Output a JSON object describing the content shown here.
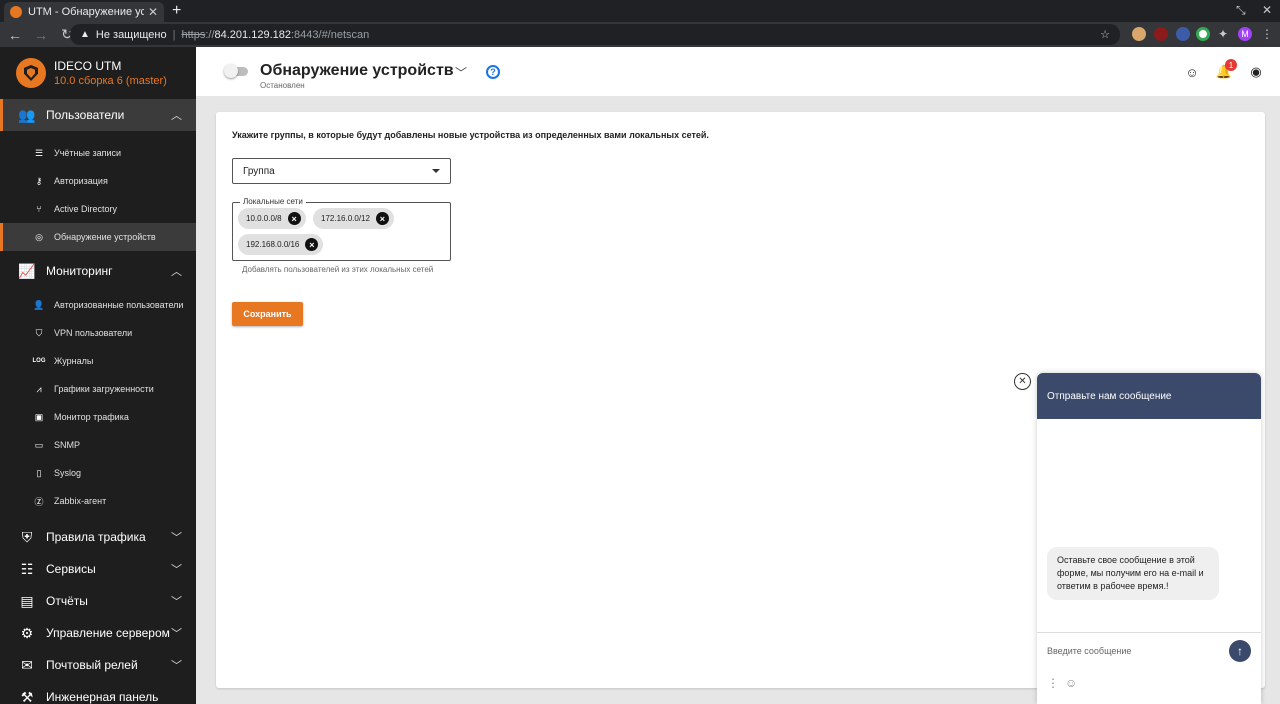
{
  "browser": {
    "tab_title": "UTM - Обнаружение устройс",
    "tab_close": "✕",
    "new_tab": "+",
    "security_label": "Не защищено",
    "url_protocol": "https",
    "url_host": "84.201.129.182",
    "url_path": ":8443/#/netscan",
    "avatar_letter": "M"
  },
  "sidebar": {
    "brand_name": "IDECO UTM",
    "brand_version": "10.0 сборка 6 (master)",
    "sections": [
      {
        "label": "Пользователи",
        "icon": "users-icon",
        "expanded": true,
        "items": [
          {
            "label": "Учётные записи",
            "icon": "list-icon"
          },
          {
            "label": "Авторизация",
            "icon": "key-icon"
          },
          {
            "label": "Active Directory",
            "icon": "tree-icon"
          },
          {
            "label": "Обнаружение устройств",
            "icon": "radar-icon",
            "active": true
          }
        ]
      },
      {
        "label": "Мониторинг",
        "icon": "chart-icon",
        "expanded": true,
        "items": [
          {
            "label": "Авторизованные пользователи",
            "icon": "user-check-icon"
          },
          {
            "label": "VPN пользователи",
            "icon": "vpn-shield-icon"
          },
          {
            "label": "Журналы",
            "icon": "log-icon"
          },
          {
            "label": "Графики загруженности",
            "icon": "graph-icon"
          },
          {
            "label": "Монитор трафика",
            "icon": "monitor-icon"
          },
          {
            "label": "SNMP",
            "icon": "server-icon"
          },
          {
            "label": "Syslog",
            "icon": "file-icon"
          },
          {
            "label": "Zabbix-агент",
            "icon": "zabbix-icon"
          }
        ]
      },
      {
        "label": "Правила трафика",
        "icon": "lock-shield-icon"
      },
      {
        "label": "Сервисы",
        "icon": "sliders-icon"
      },
      {
        "label": "Отчёты",
        "icon": "report-icon"
      },
      {
        "label": "Управление сервером",
        "icon": "gear-icon"
      },
      {
        "label": "Почтовый релей",
        "icon": "mail-icon"
      },
      {
        "label": "Инженерная панель",
        "icon": "engineering-icon"
      }
    ]
  },
  "header": {
    "title": "Обнаружение устройств",
    "status": "Остановлен",
    "help_symbol": "?",
    "notification_count": "1"
  },
  "form": {
    "intro": "Укажите группы, в которые будут добавлены новые устройства из определенных вами локальных сетей.",
    "group_select": "Группа",
    "networks_legend": "Локальные сети",
    "networks": [
      "10.0.0.0/8",
      "172.16.0.0/12",
      "192.168.0.0/16"
    ],
    "helper": "Добавлять пользователей из этих локальных сетей",
    "save_label": "Сохранить"
  },
  "chat": {
    "close_symbol": "✕",
    "header": "Отправьте нам сообщение",
    "message": "Оставьте свое сообщение в этой форме, мы получим его на e-mail и ответим в рабочее время.!",
    "input_placeholder": "Введите сообщение",
    "send_symbol": "↑"
  },
  "colors": {
    "accent": "#e87722",
    "sidebar_bg": "#1e1e1e",
    "chat_header": "#3b4a6b"
  }
}
